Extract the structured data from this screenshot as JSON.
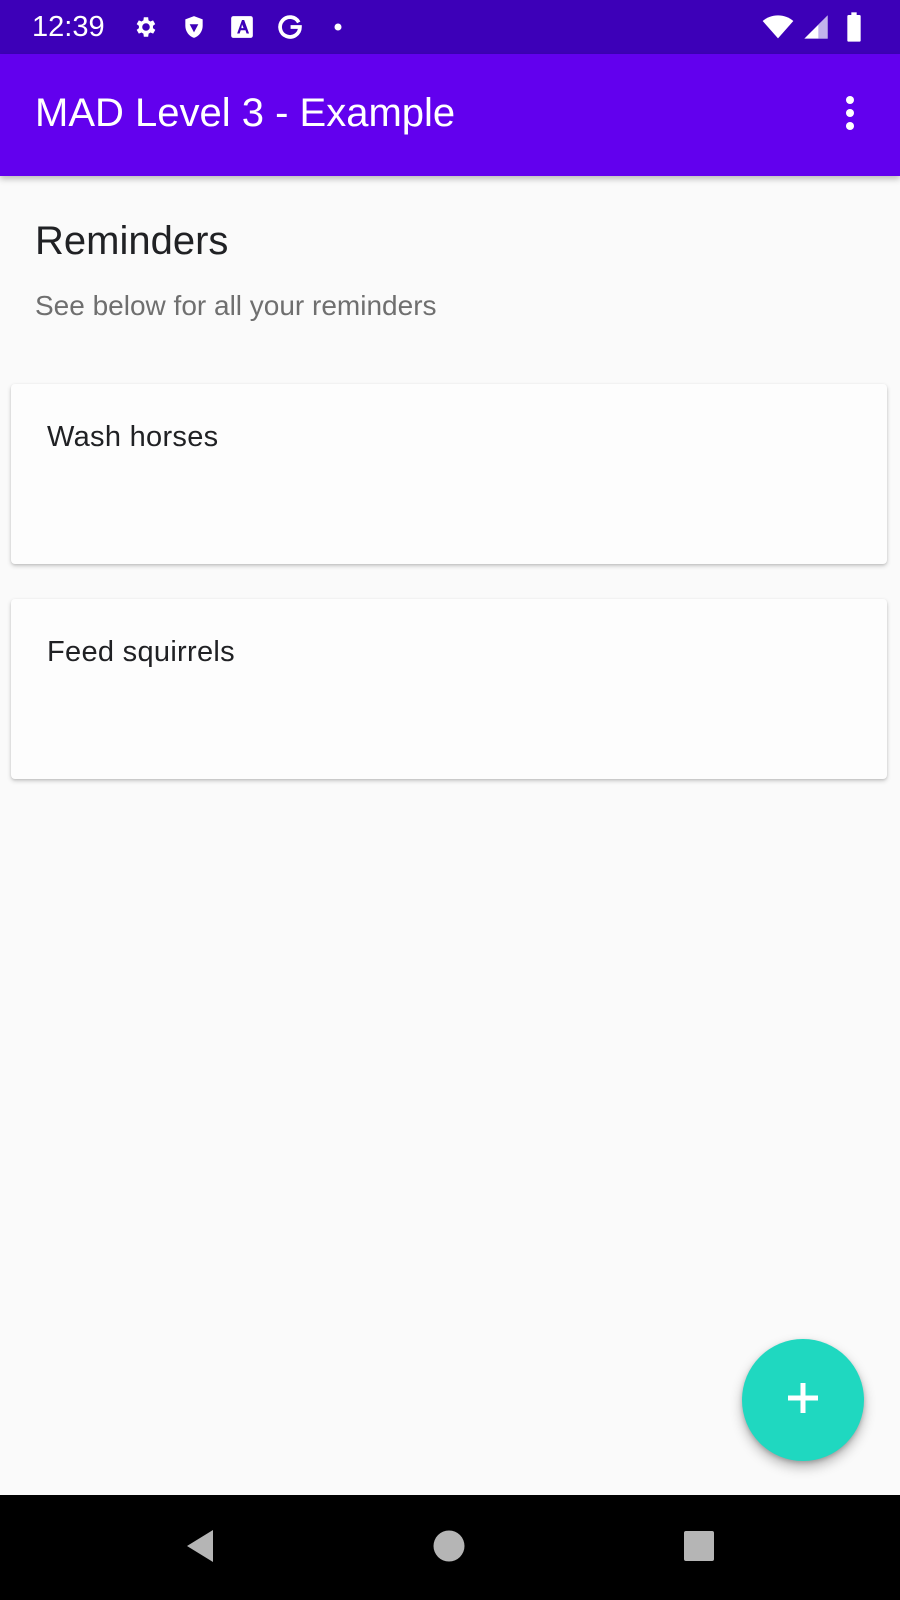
{
  "status_bar": {
    "time": "12:39",
    "left_icons": [
      "gear-icon",
      "shield-icon",
      "font-a-icon",
      "google-g-icon",
      "dot-icon"
    ],
    "right_icons": [
      "wifi-icon",
      "signal-icon",
      "battery-icon"
    ],
    "background_color": "#3d00b8"
  },
  "app_bar": {
    "title": "MAD Level 3 - Example",
    "overflow_icon": "more-vert-icon",
    "background_color": "#6200ee"
  },
  "main": {
    "title": "Reminders",
    "subtitle": "See below for all your reminders",
    "reminders": [
      {
        "text": "Wash horses"
      },
      {
        "text": "Feed squirrels"
      }
    ]
  },
  "fab": {
    "icon": "plus-icon",
    "color": "#1fd8c0"
  },
  "nav_bar": {
    "buttons": [
      "back-icon",
      "home-icon",
      "recents-icon"
    ]
  }
}
